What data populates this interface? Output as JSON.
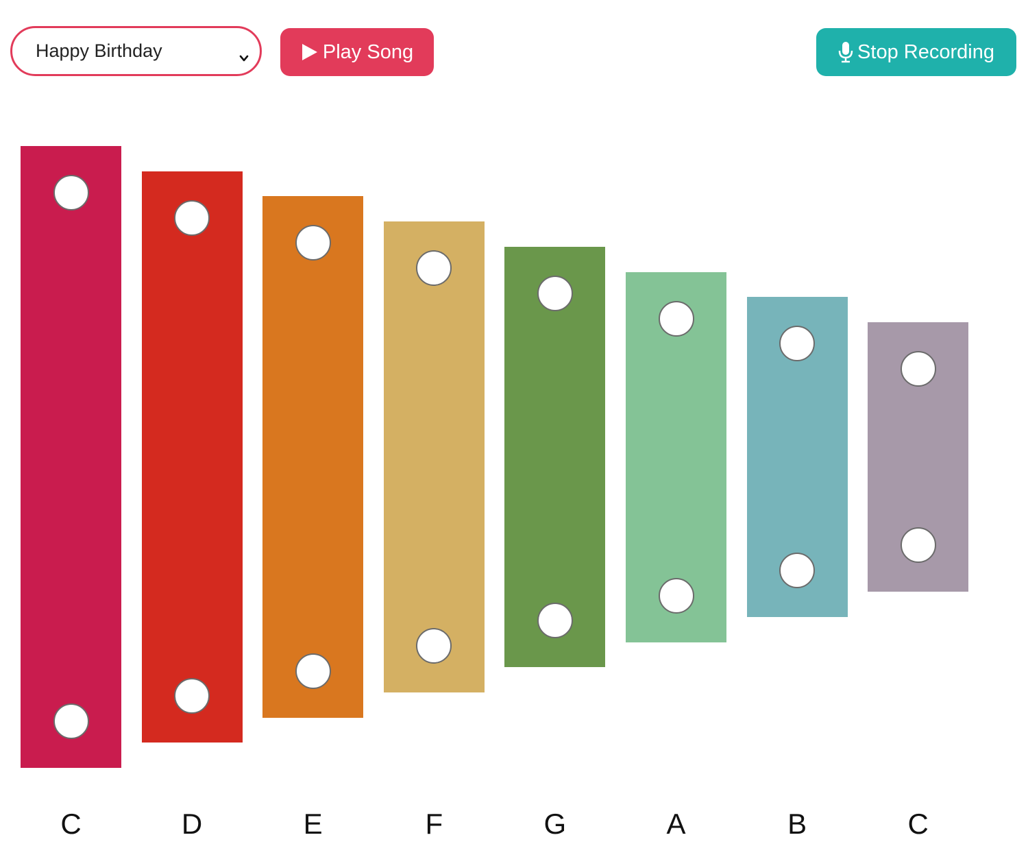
{
  "toolbar": {
    "song_select": {
      "value": "Happy Birthday",
      "icon": "chevron-down-icon"
    },
    "play_button": {
      "label": "Play Song",
      "icon": "play-icon"
    },
    "record_button": {
      "label": "Stop Recording",
      "icon": "microphone-icon"
    }
  },
  "xylophone": {
    "bars": [
      {
        "note": "C",
        "color": "#c91c4e"
      },
      {
        "note": "D",
        "color": "#d42a1f"
      },
      {
        "note": "E",
        "color": "#d9771f"
      },
      {
        "note": "F",
        "color": "#d4b063"
      },
      {
        "note": "G",
        "color": "#6a974b"
      },
      {
        "note": "A",
        "color": "#84c396"
      },
      {
        "note": "B",
        "color": "#77b4ba"
      },
      {
        "note": "C",
        "color": "#a799a9"
      }
    ]
  },
  "colors": {
    "accent": "#e23b5a",
    "recording": "#1fb1ab"
  }
}
